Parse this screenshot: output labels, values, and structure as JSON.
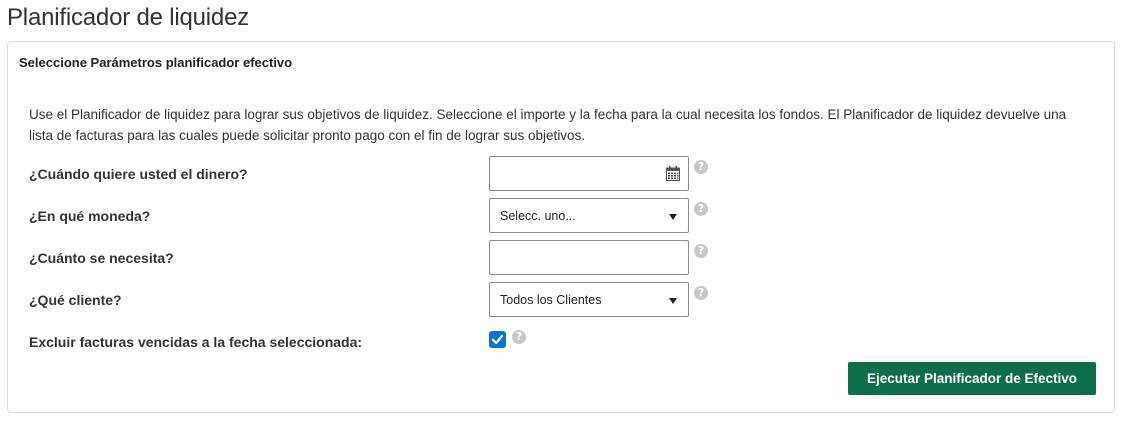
{
  "page": {
    "title": "Planificador de liquidez"
  },
  "panel": {
    "header": "Seleccione Parámetros planificador efectivo",
    "description": "Use el Planificador de liquidez para lograr sus objetivos de liquidez. Seleccione el importe y la fecha para la cual necesita los fondos. El Planificador de liquidez devuelve una lista de facturas para las cuales puede solicitar pronto pago con el fin de lograr sus objetivos."
  },
  "form": {
    "when": {
      "label": "¿Cuándo quiere usted el dinero?",
      "value": "",
      "icon": "calendar-icon"
    },
    "currency": {
      "label": "¿En qué moneda?",
      "selected": "Selecc. uno..."
    },
    "amount": {
      "label": "¿Cuánto se necesita?",
      "value": ""
    },
    "client": {
      "label": "¿Qué cliente?",
      "selected": "Todos los Clientes"
    },
    "exclude": {
      "label": "Excluir facturas vencidas a la fecha seleccionada:",
      "checked": true
    },
    "help_glyph": "?"
  },
  "actions": {
    "run_label": "Ejecutar Planificador de Efectivo"
  },
  "colors": {
    "primary_button": "#0e6e47",
    "checkbox": "#0a72d9",
    "help_icon": "#c8c8c8"
  }
}
